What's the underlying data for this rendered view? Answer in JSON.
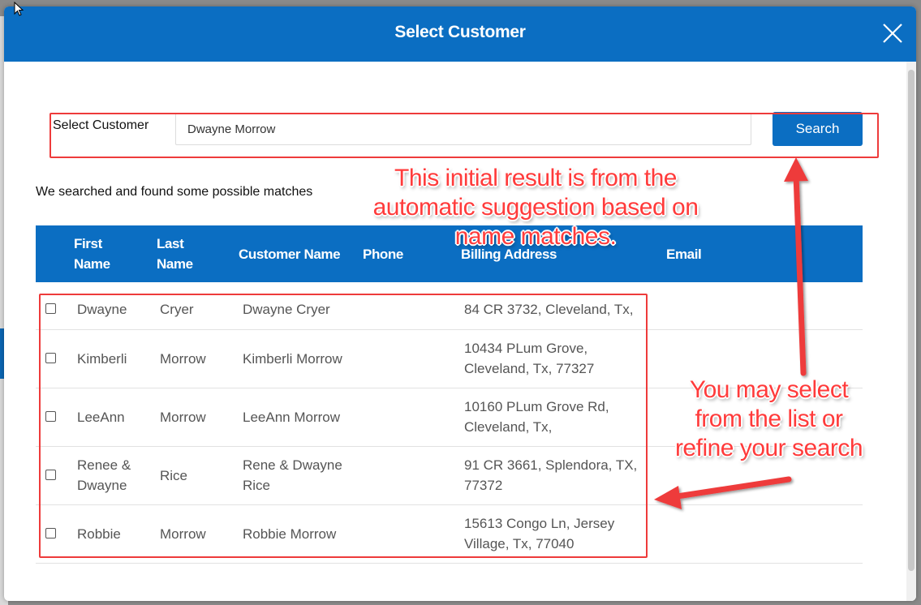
{
  "modal": {
    "title": "Select Customer"
  },
  "search": {
    "label": "Select Customer",
    "value": "Dwayne Morrow",
    "button_label": "Search"
  },
  "results": {
    "message": "We searched and found some possible matches",
    "columns": {
      "first_name_1": "First",
      "first_name_2": "Name",
      "last_name_1": "Last",
      "last_name_2": "Name",
      "customer_name": "Customer Name",
      "phone": "Phone",
      "billing_address": "Billing Address",
      "email": "Email"
    },
    "rows": [
      {
        "first": "Dwayne",
        "first2": "",
        "last": "Cryer",
        "customer": "Dwayne Cryer",
        "customer2": "",
        "phone": "",
        "addr1": "84 CR 3732, Cleveland, Tx,",
        "addr2": "",
        "email": ""
      },
      {
        "first": "Kimberli",
        "first2": "",
        "last": "Morrow",
        "customer": "Kimberli Morrow",
        "customer2": "",
        "phone": "",
        "addr1": "10434 PLum Grove,",
        "addr2": "Cleveland, Tx, 77327",
        "email": ""
      },
      {
        "first": "LeeAnn",
        "first2": "",
        "last": "Morrow",
        "customer": "LeeAnn Morrow",
        "customer2": "",
        "phone": "",
        "addr1": "10160 PLum Grove Rd,",
        "addr2": "Cleveland, Tx,",
        "email": ""
      },
      {
        "first": "Renee &",
        "first2": "Dwayne",
        "last": "Rice",
        "customer": "Rene & Dwayne",
        "customer2": "Rice",
        "phone": "",
        "addr1": "91 CR 3661, Splendora, TX,",
        "addr2": "77372",
        "email": ""
      },
      {
        "first": "Robbie",
        "first2": "",
        "last": "Morrow",
        "customer": "Robbie Morrow",
        "customer2": "",
        "phone": "",
        "addr1": "15613 Congo Ln, Jersey",
        "addr2": "Village, Tx, 77040",
        "email": ""
      }
    ]
  },
  "annotations": {
    "callout_top_1": "This initial result is from the",
    "callout_top_2": "automatic suggestion based on",
    "callout_top_3": "name matches.",
    "callout_right_1": "You may select",
    "callout_right_2": "from the list or",
    "callout_right_3": "refine your search",
    "color": "#ee3b3b"
  },
  "colors": {
    "header_blue": "#0b6ec2",
    "overlay": "#8a8a8a"
  }
}
